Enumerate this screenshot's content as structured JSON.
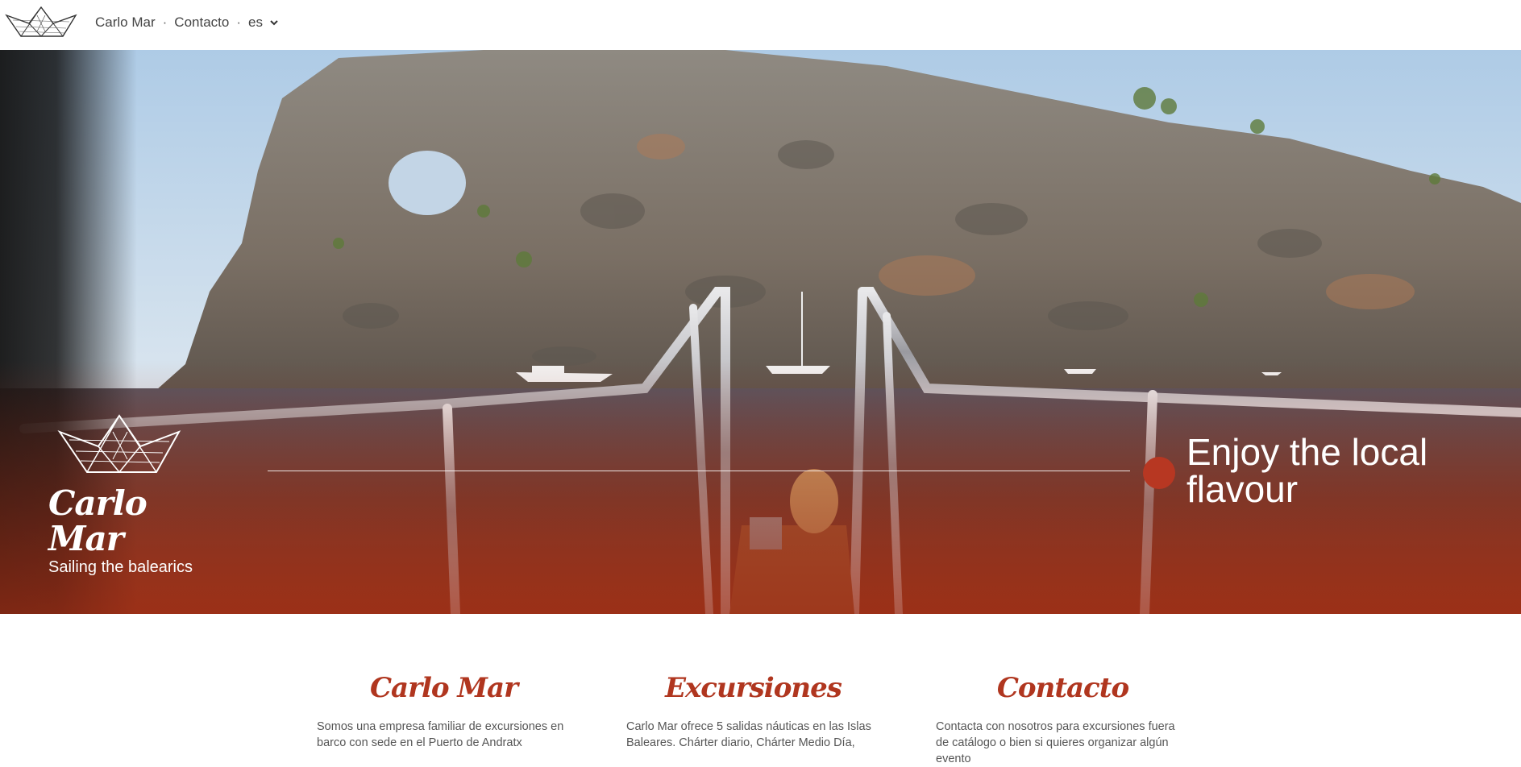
{
  "header": {
    "nav": {
      "home_label": "Carlo Mar",
      "separator": "·",
      "contact_label": "Contacto",
      "lang_label": "es"
    }
  },
  "hero": {
    "brand_name": "Carlo Mar",
    "brand_tagline": "Sailing the balearics",
    "slogan": "Enjoy the local flavour"
  },
  "columns": [
    {
      "title": "Carlo Mar",
      "text": "Somos una empresa familiar de excursiones en barco con sede en el Puerto de Andratx"
    },
    {
      "title": "Excursiones",
      "text": "Carlo Mar ofrece 5 salidas náuticas en las Islas Baleares. Chárter diario, Chárter Medio Día,"
    },
    {
      "title": "Contacto",
      "text": "Contacta con nosotros para excursiones fuera de catálogo o bien si quieres organizar algún evento"
    }
  ],
  "colors": {
    "accent": "#b0361f",
    "dot": "#b73722"
  }
}
